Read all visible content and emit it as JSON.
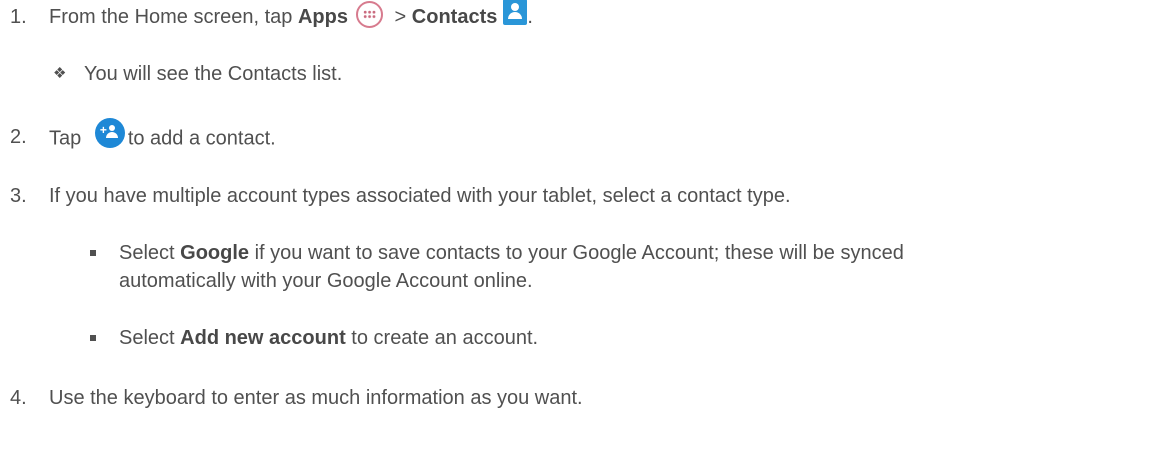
{
  "steps": [
    {
      "number": "1.",
      "prefix": "From the Home screen, tap ",
      "apps_label": "Apps",
      "separator": " > ",
      "contacts_label": "Contacts",
      "suffix": "."
    },
    {
      "number": "2.",
      "prefix": "Tap ",
      "suffix": "to add a contact."
    },
    {
      "number": "3.",
      "text": "If you have multiple account types associated with your tablet, select a contact type."
    },
    {
      "number": "4.",
      "text": "Use the keyboard to enter as much information as you want."
    }
  ],
  "step1_note": "You will see the Contacts list.",
  "step3_options": [
    {
      "select_word": "Select ",
      "name": "Google",
      "text_line1": " if you want to save contacts to your Google Account; these will be synced",
      "text_line2": "automatically with your Google Account online."
    },
    {
      "select_word": "Select ",
      "name": "Add new account",
      "text_line1": " to create an account."
    }
  ],
  "icons": {
    "apps": "apps-grid-icon",
    "contacts": "contacts-app-icon",
    "add_contact": "add-contact-icon"
  },
  "colors": {
    "text": "#505050",
    "apps_icon_ring": "#d77b8e",
    "contacts_icon": "#2a96d8",
    "add_contact_icon": "#1e88d6"
  }
}
